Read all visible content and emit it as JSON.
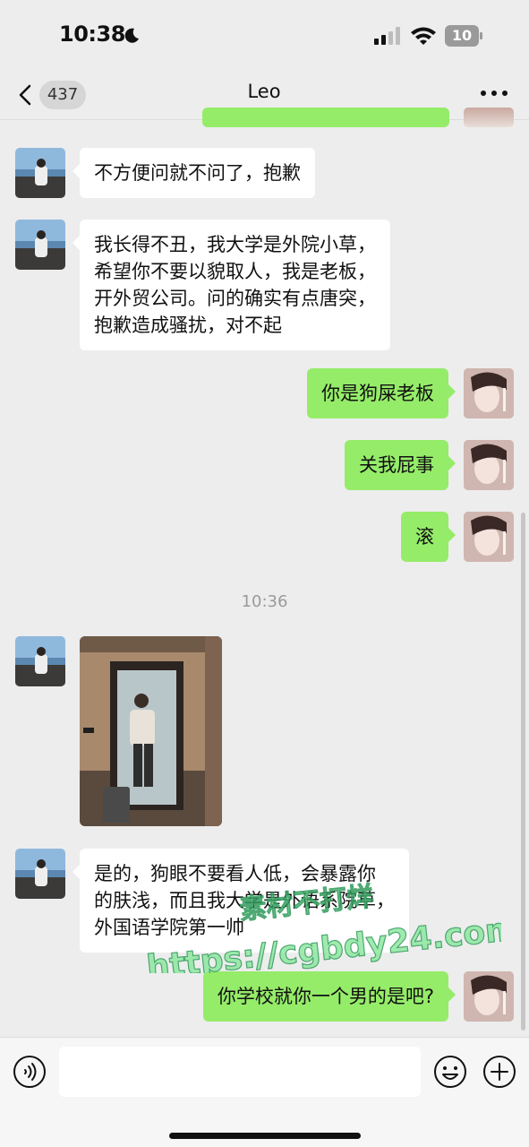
{
  "status_bar": {
    "time": "10:38",
    "battery": "10"
  },
  "nav": {
    "unread_count": "437",
    "title": "Leo"
  },
  "messages": [
    {
      "text": "不方便问就不问了，抱歉"
    },
    {
      "text": "我长得不丑，我大学是外院小草，\n希望你不要以貌取人，我是老板，\n开外贸公司。问的确实有点唐突，\n抱歉造成骚扰，对不起"
    },
    {
      "text": "你是狗屎老板"
    },
    {
      "text": "关我屁事"
    },
    {
      "text": "滚"
    },
    {
      "text": "是的，狗眼不要看人低，会暴露你\n的肤浅，而且我大学是外语系院草，\n外国语学院第一帅"
    },
    {
      "text": "你学校就你一个男的是吧?"
    }
  ],
  "timestamp": "10:36",
  "watermark": {
    "line1": "素材不打烊",
    "line2": "https://cgbdy24.com"
  },
  "colors": {
    "background": "#EDEDED",
    "outgoing_bubble": "#95EC69",
    "incoming_bubble": "#FFFFFF"
  },
  "icons": [
    "moon-icon",
    "signal-icon",
    "wifi-icon",
    "battery-icon",
    "back-chevron-icon",
    "more-icon",
    "voice-icon",
    "emoji-icon",
    "plus-icon"
  ]
}
